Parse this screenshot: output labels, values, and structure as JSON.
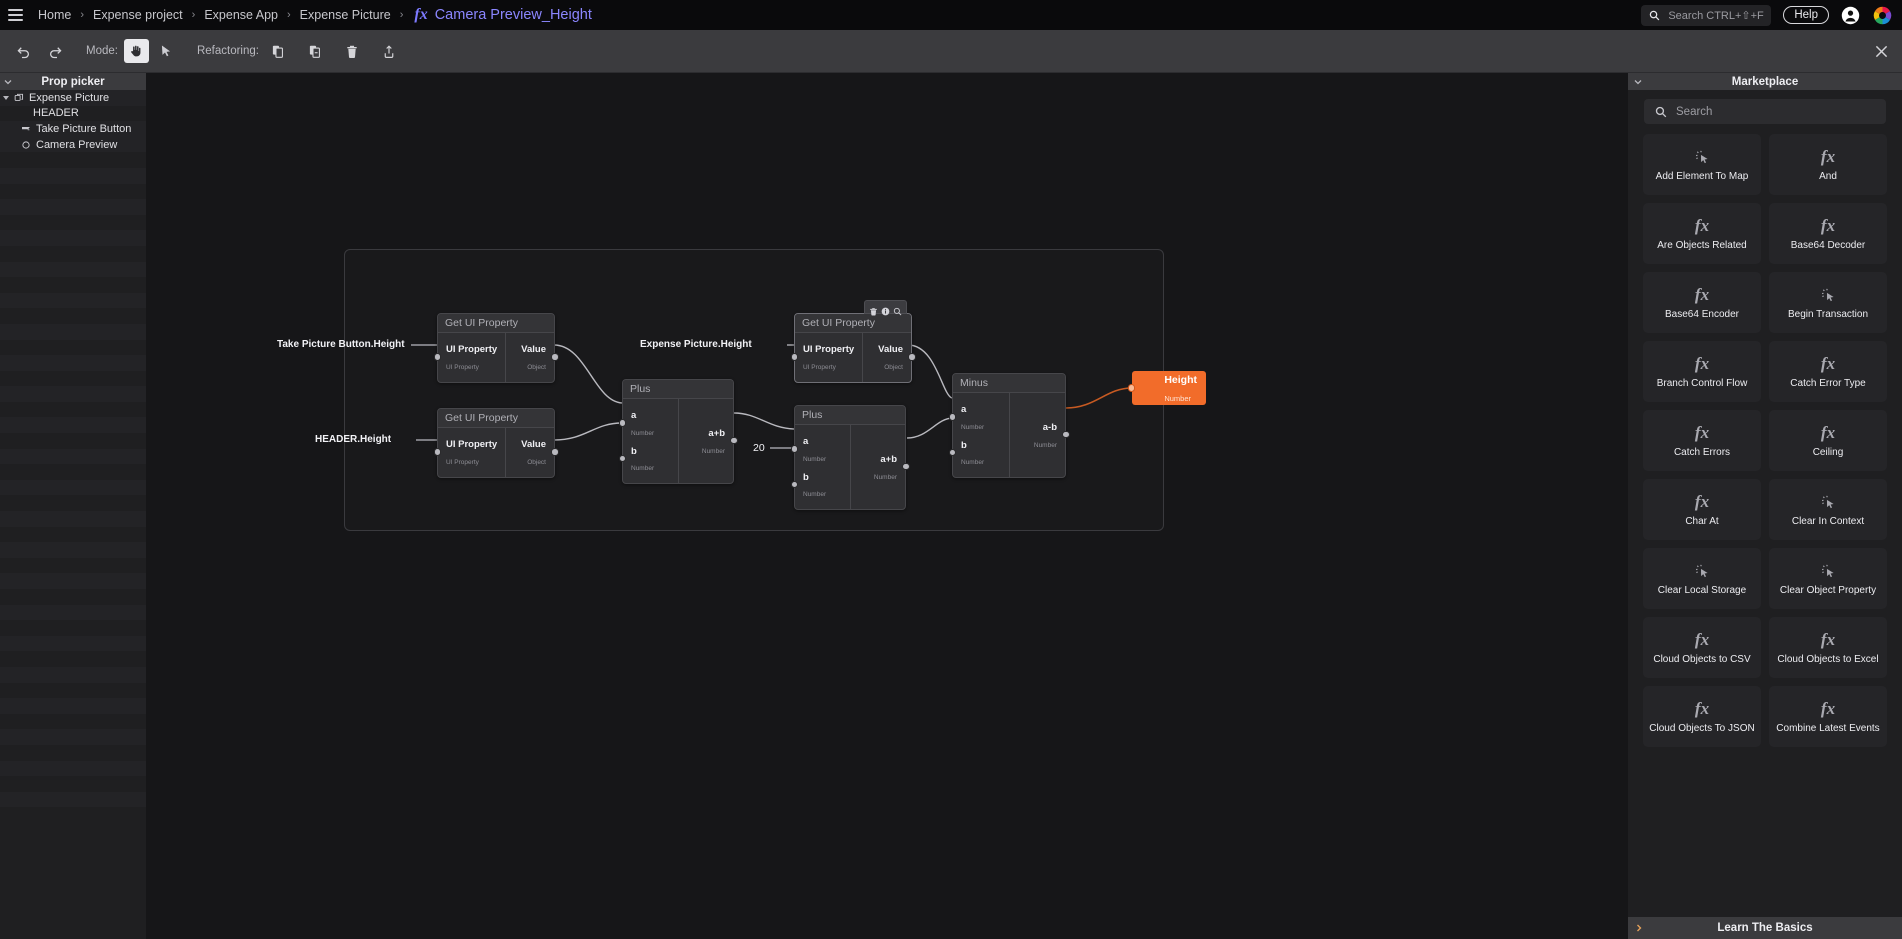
{
  "topbar": {
    "menu_icon": "hamburger-icon",
    "breadcrumbs": [
      "Home",
      "Expense project",
      "Expense App",
      "Expense Picture"
    ],
    "separator": "›",
    "fx_icon": "fx-icon",
    "page_title": "Camera Preview_Height",
    "search": {
      "icon": "search-icon",
      "placeholder": "Search CTRL+⇧+F"
    },
    "help_label": "Help",
    "account_icon": "user-account-icon",
    "logo_icon": "app-logo-icon"
  },
  "toolbar": {
    "undo_icon": "undo-icon",
    "redo_icon": "redo-icon",
    "mode_label": "Mode:",
    "mode_pan_icon": "hand-pan-icon",
    "mode_select_icon": "cursor-select-icon",
    "refactoring_label": "Refactoring:",
    "copy_icon": "copy-icon",
    "paste_icon": "paste-icon",
    "delete_icon": "trash-icon",
    "extract_icon": "extract-upload-icon",
    "close_icon": "close-icon"
  },
  "sidebar": {
    "title": "Prop picker",
    "collapse_icon": "chevron-down-icon",
    "items": [
      {
        "label": "Expense Picture",
        "icon": "component-icon",
        "indent": 1,
        "expanded": true
      },
      {
        "label": "HEADER",
        "icon": "",
        "indent": 3,
        "expanded": false
      },
      {
        "label": "Take Picture Button",
        "icon": "button-icon",
        "indent": 2,
        "expanded": false
      },
      {
        "label": "Camera Preview",
        "icon": "circle-icon",
        "indent": 2,
        "expanded": false
      }
    ]
  },
  "canvas": {
    "cursor_icon": "hand-cursor-icon",
    "nodes": [
      {
        "id": "get1",
        "title": "Get UI Property",
        "inputs": [
          {
            "name": "UI Property",
            "type": "UI Property"
          }
        ],
        "outputs": [
          {
            "name": "Value",
            "type": "Object"
          }
        ],
        "selected": false
      },
      {
        "id": "get2",
        "title": "Get UI Property",
        "inputs": [
          {
            "name": "UI Property",
            "type": "UI Property"
          }
        ],
        "outputs": [
          {
            "name": "Value",
            "type": "Object"
          }
        ],
        "selected": false
      },
      {
        "id": "get3",
        "title": "Get UI Property",
        "inputs": [
          {
            "name": "UI Property",
            "type": "UI Property"
          }
        ],
        "outputs": [
          {
            "name": "Value",
            "type": "Object"
          }
        ],
        "selected": true,
        "tools": [
          "trash-icon",
          "info-icon",
          "magnifier-icon"
        ]
      },
      {
        "id": "plus1",
        "title": "Plus",
        "inputs": [
          {
            "name": "a",
            "type": "Number"
          },
          {
            "name": "b",
            "type": "Number"
          }
        ],
        "outputs": [
          {
            "name": "a+b",
            "type": "Number"
          }
        ],
        "selected": false
      },
      {
        "id": "plus2",
        "title": "Plus",
        "inputs": [
          {
            "name": "a",
            "type": "Number"
          },
          {
            "name": "b",
            "type": "Number"
          }
        ],
        "outputs": [
          {
            "name": "a+b",
            "type": "Number"
          }
        ],
        "selected": false
      },
      {
        "id": "minus1",
        "title": "Minus",
        "inputs": [
          {
            "name": "a",
            "type": "Number"
          },
          {
            "name": "b",
            "type": "Number"
          }
        ],
        "outputs": [
          {
            "name": "a-b",
            "type": "Number"
          }
        ],
        "selected": false
      }
    ],
    "labels": {
      "take_picture_button_height": "Take Picture Button.Height",
      "header_height": "HEADER.Height",
      "expense_picture_height": "Expense Picture.Height",
      "literal_20": "20"
    },
    "output_node": {
      "name": "Height",
      "type": "Number",
      "color": "#f26c2a"
    }
  },
  "marketplace": {
    "title": "Marketplace",
    "collapse_icon": "chevron-down-icon",
    "search": {
      "icon": "search-icon",
      "placeholder": "Search"
    },
    "tiles": [
      {
        "label": "Add Element To Map",
        "icon": "click-action-icon"
      },
      {
        "label": "And",
        "icon": "fx-icon"
      },
      {
        "label": "Are Objects Related",
        "icon": "fx-icon"
      },
      {
        "label": "Base64 Decoder",
        "icon": "fx-icon"
      },
      {
        "label": "Base64 Encoder",
        "icon": "fx-icon"
      },
      {
        "label": "Begin Transaction",
        "icon": "click-action-icon"
      },
      {
        "label": "Branch Control Flow",
        "icon": "fx-icon"
      },
      {
        "label": "Catch Error Type",
        "icon": "fx-icon"
      },
      {
        "label": "Catch Errors",
        "icon": "fx-icon"
      },
      {
        "label": "Ceiling",
        "icon": "fx-icon"
      },
      {
        "label": "Char At",
        "icon": "fx-icon"
      },
      {
        "label": "Clear In Context",
        "icon": "click-action-icon"
      },
      {
        "label": "Clear Local Storage",
        "icon": "click-action-icon"
      },
      {
        "label": "Clear Object Property",
        "icon": "click-action-icon"
      },
      {
        "label": "Cloud Objects to CSV",
        "icon": "fx-icon"
      },
      {
        "label": "Cloud Objects to Excel",
        "icon": "fx-icon"
      },
      {
        "label": "Cloud Objects To JSON",
        "icon": "fx-icon"
      },
      {
        "label": "Combine Latest Events",
        "icon": "fx-icon"
      }
    ],
    "footer": {
      "label": "Learn The Basics",
      "icon": "chevron-right-icon"
    }
  }
}
